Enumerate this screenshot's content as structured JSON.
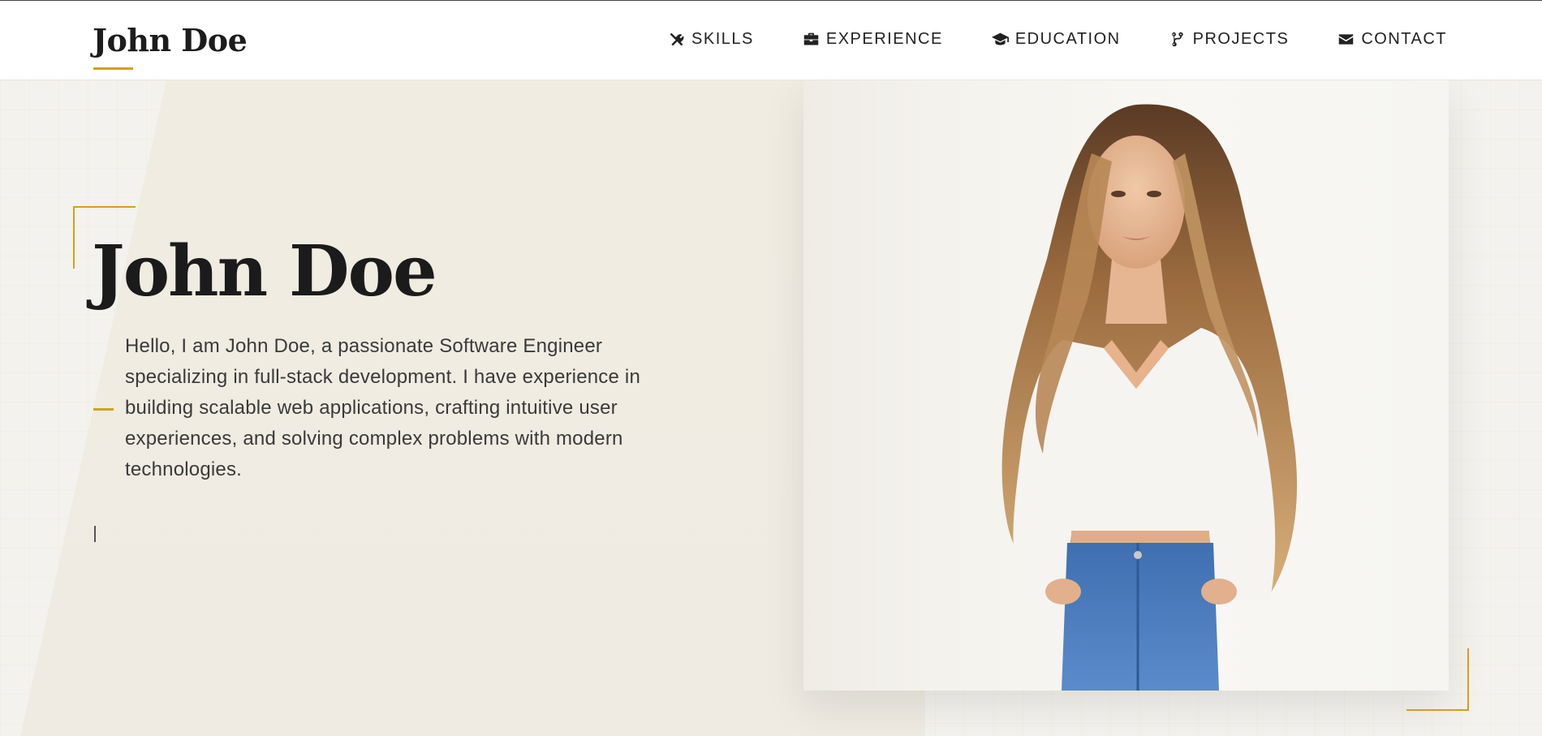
{
  "header": {
    "logo": "John Doe",
    "nav": [
      {
        "label": "SKILLS",
        "icon": "tools-icon"
      },
      {
        "label": "EXPERIENCE",
        "icon": "briefcase-icon"
      },
      {
        "label": "EDUCATION",
        "icon": "graduation-cap-icon"
      },
      {
        "label": "PROJECTS",
        "icon": "code-branch-icon"
      },
      {
        "label": "CONTACT",
        "icon": "envelope-icon"
      }
    ]
  },
  "hero": {
    "name": "John Doe",
    "bio": "Hello, I am John Doe, a passionate Software Engineer specializing in full-stack development. I have experience in building scalable web applications, crafting intuitive user experiences, and solving complex problems with modern technologies.",
    "photo": "portrait-photo"
  },
  "colors": {
    "accent": "#d4a017",
    "text": "#1b1b1b",
    "background": "#f3f2ee"
  }
}
